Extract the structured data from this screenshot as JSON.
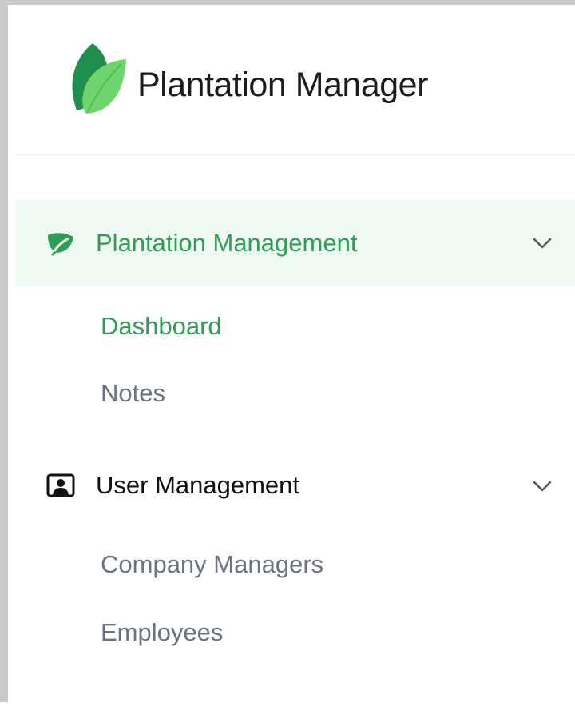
{
  "brand": {
    "title": "Plantation Manager",
    "logo_icon": "leaf-logo-icon",
    "colors": {
      "leaf_dark": "#1f8f4e",
      "leaf_light": "#6fd46b"
    }
  },
  "nav": {
    "groups": [
      {
        "label": "Plantation Management",
        "icon": "leaf-icon",
        "active": true,
        "expanded": true,
        "items": [
          {
            "label": "Dashboard",
            "active": true
          },
          {
            "label": "Notes",
            "active": false
          }
        ]
      },
      {
        "label": "User Management",
        "icon": "user-card-icon",
        "active": false,
        "expanded": true,
        "items": [
          {
            "label": "Company Managers",
            "active": false
          },
          {
            "label": "Employees",
            "active": false
          }
        ]
      }
    ]
  },
  "colors": {
    "accent": "#2f9e55",
    "active_bg": "#effaf2",
    "muted_text": "#6b7280",
    "dark_text": "#111111"
  }
}
